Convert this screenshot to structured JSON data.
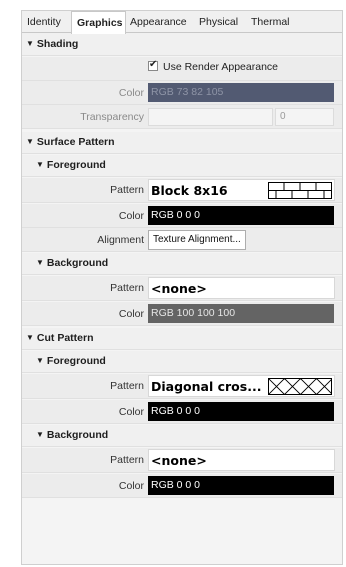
{
  "tabs": [
    {
      "label": "Identity"
    },
    {
      "label": "Graphics"
    },
    {
      "label": "Appearance"
    },
    {
      "label": "Physical"
    },
    {
      "label": "Thermal"
    }
  ],
  "active_tab": "Graphics",
  "shading": {
    "title": "Shading",
    "use_render_appearance_label": "Use Render Appearance",
    "use_render_appearance_checked": true,
    "color_label": "Color",
    "color_value": "RGB 73 82 105",
    "color_hex": "#525a72",
    "transparency_label": "Transparency",
    "transparency_value": "0"
  },
  "surface_pattern": {
    "title": "Surface Pattern",
    "foreground": {
      "title": "Foreground",
      "pattern_label": "Pattern",
      "pattern_value": "Block 8x16",
      "pattern_icon": "brick-block-pattern-preview",
      "color_label": "Color",
      "color_value": "RGB 0 0 0",
      "color_hex": "#000000",
      "alignment_label": "Alignment",
      "alignment_button": "Texture Alignment..."
    },
    "background": {
      "title": "Background",
      "pattern_label": "Pattern",
      "pattern_value": "<none>",
      "color_label": "Color",
      "color_value": "RGB 100 100 100",
      "color_hex": "#646464"
    }
  },
  "cut_pattern": {
    "title": "Cut Pattern",
    "foreground": {
      "title": "Foreground",
      "pattern_label": "Pattern",
      "pattern_value": "Diagonal cros...",
      "pattern_icon": "diagonal-crosshatch-pattern-preview",
      "color_label": "Color",
      "color_value": "RGB 0 0 0",
      "color_hex": "#000000"
    },
    "background": {
      "title": "Background",
      "pattern_label": "Pattern",
      "pattern_value": "<none>",
      "color_label": "Color",
      "color_value": "RGB 0 0 0",
      "color_hex": "#000000"
    }
  }
}
